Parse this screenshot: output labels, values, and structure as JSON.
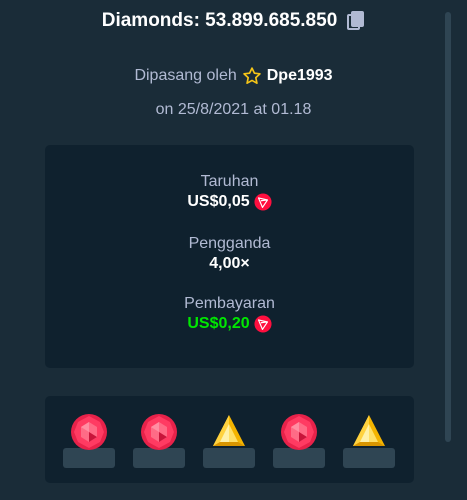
{
  "header": {
    "title": "Diamonds: 53.899.685.850",
    "copy_icon": "copy-icon"
  },
  "placed": {
    "prefix": "Dipasang oleh",
    "username": "Dpe1993",
    "user_icon": "star-icon",
    "date": "on 25/8/2021 at 01.18"
  },
  "stats": {
    "bet_label": "Taruhan",
    "bet_value": "US$0,05",
    "multiplier_label": "Pengganda",
    "multiplier_value": "4,00×",
    "payout_label": "Pembayaran",
    "payout_value": "US$0,20",
    "currency_icon": "tron-coin-icon"
  },
  "tiles": [
    {
      "gem": "red"
    },
    {
      "gem": "red"
    },
    {
      "gem": "yellow"
    },
    {
      "gem": "red"
    },
    {
      "gem": "yellow"
    }
  ],
  "colors": {
    "background": "#1a2c38",
    "panel": "#0f212e",
    "text_muted": "#b1bad3",
    "green": "#00e701",
    "coin_red": "#ff0f3f",
    "star": "#f5c518"
  }
}
